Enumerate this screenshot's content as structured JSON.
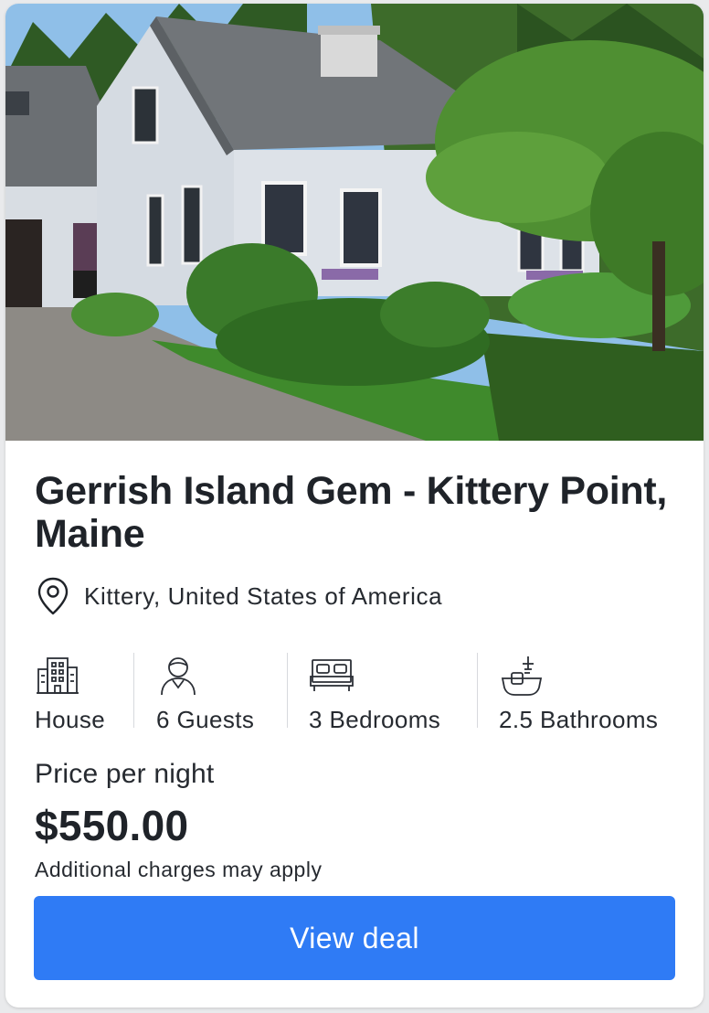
{
  "listing": {
    "title": "Gerrish Island Gem - Kittery Point, Maine",
    "location": "Kittery, United States of America",
    "features": [
      {
        "icon": "building-icon",
        "label": "House"
      },
      {
        "icon": "guest-icon",
        "label": "6 Guests"
      },
      {
        "icon": "bed-icon",
        "label": "3 Bedrooms"
      },
      {
        "icon": "bathtub-icon",
        "label": "2.5 Bathrooms"
      }
    ],
    "price_label": "Price per night",
    "price": "$550.00",
    "price_note": "Additional charges may apply",
    "cta_label": "View deal"
  },
  "colors": {
    "accent": "#2f7bf5",
    "text": "#1f2329",
    "icon_stroke": "#2b2f36"
  }
}
